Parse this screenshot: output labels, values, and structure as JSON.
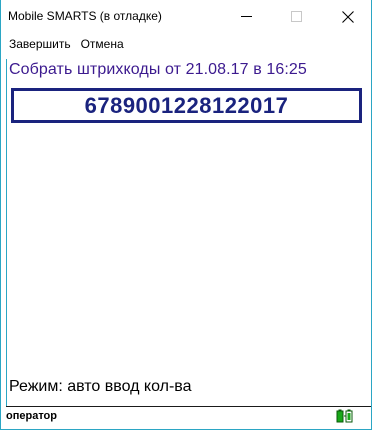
{
  "window": {
    "title": "Mobile SMARTS (в отладке)",
    "controls": [
      "minimize-icon",
      "maximize-icon",
      "close-icon"
    ]
  },
  "menu": {
    "finish_label": "Завершить",
    "cancel_label": "Отмена"
  },
  "screen": {
    "header": "Собрать штрихкоды от 21.08.17 в 16:25",
    "barcode": "6789001228122017",
    "mode": "Режим: авто ввод кол-ва"
  },
  "status": {
    "user": "оператор",
    "battery_icon": "battery-charging-icon",
    "battery_color": "#18a818"
  },
  "colors": {
    "accent_border": "#2ba6c4",
    "header_text": "#3c1a8f",
    "barcode_frame": "#1a237e"
  }
}
